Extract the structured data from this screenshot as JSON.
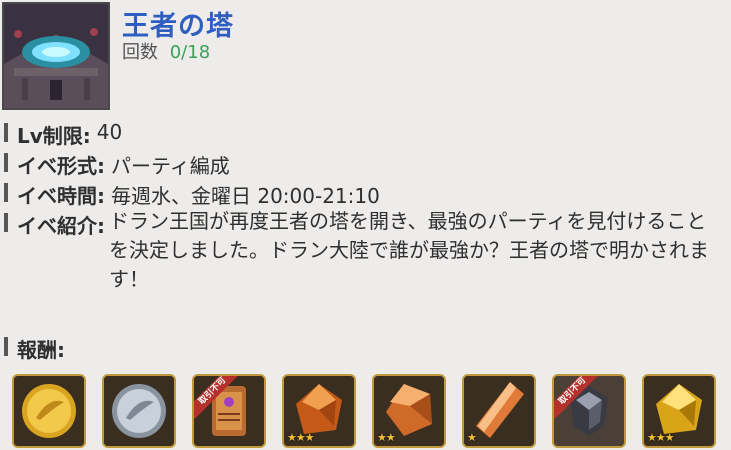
{
  "event": {
    "title": "王者の塔",
    "count_label": "回数",
    "count_value": "0/18"
  },
  "info": [
    {
      "label": "Lv制限:",
      "value": "40"
    },
    {
      "label": "イベ形式:",
      "value": "パーティ編成"
    },
    {
      "label": "イベ時間:",
      "value": "毎週水、金曜日 20:00-21:10"
    },
    {
      "label": "イベ紹介:",
      "value": "ドラン王国が再度王者の塔を開き、最強のパーティを見付けることを決定しました。ドラン大陸で誰が最強か？王者の塔で明かされます！"
    }
  ],
  "rewards": {
    "label": "報酬:",
    "items": [
      {
        "icon": "gold-coin-icon",
        "ribbon": "",
        "stars": ""
      },
      {
        "icon": "silver-coin-icon",
        "ribbon": "",
        "stars": ""
      },
      {
        "icon": "scroll-icon",
        "ribbon": "取引不可",
        "stars": ""
      },
      {
        "icon": "orange-gem-icon",
        "ribbon": "",
        "stars": "★★★"
      },
      {
        "icon": "orange-gem-icon",
        "ribbon": "",
        "stars": "★★"
      },
      {
        "icon": "orange-crystal-icon",
        "ribbon": "",
        "stars": "★"
      },
      {
        "icon": "armor-piece-icon",
        "ribbon": "取引不可",
        "stars": ""
      },
      {
        "icon": "gold-gem-icon",
        "ribbon": "",
        "stars": "★★★"
      }
    ]
  },
  "colors": {
    "title": "#2e5fc0",
    "count_value": "#3aa15a",
    "ribbon": "#b7312c",
    "stars": "#f2c030"
  }
}
